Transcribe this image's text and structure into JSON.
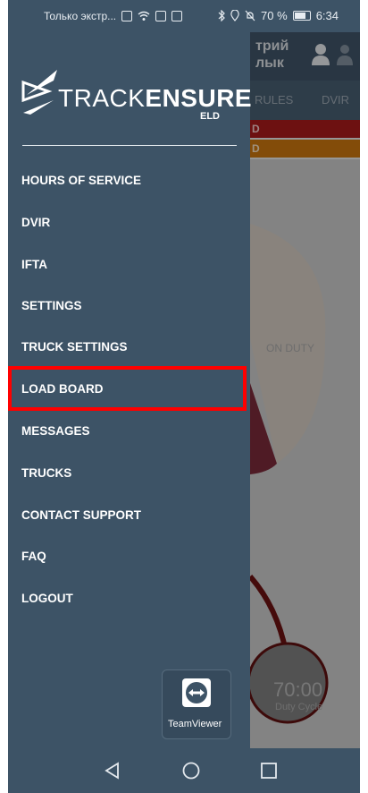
{
  "status_bar": {
    "carrier": "Только экстр...",
    "battery": "70 %",
    "time": "6:34"
  },
  "background_app": {
    "title": "трий\nлык",
    "tab_rules": "RULES",
    "tab_dvir": "DVIR",
    "alert_red": "D",
    "alert_orange": "D",
    "duty_label": "ON DUTY",
    "duty_cycle_time": "70:00",
    "duty_cycle_label": "Duty Cycle"
  },
  "drawer": {
    "brand_thin": "TRACK",
    "brand_bold": "ENSURE",
    "brand_sub": "ELD",
    "menu": [
      {
        "label": "HOURS OF SERVICE"
      },
      {
        "label": "DVIR"
      },
      {
        "label": "IFTA"
      },
      {
        "label": "SETTINGS"
      },
      {
        "label": "TRUCK SETTINGS"
      },
      {
        "label": "LOAD BOARD"
      },
      {
        "label": "MESSAGES"
      },
      {
        "label": "TRUCKS"
      },
      {
        "label": "CONTACT SUPPORT"
      },
      {
        "label": "FAQ"
      },
      {
        "label": "LOGOUT"
      }
    ],
    "teamviewer_label": "TeamViewer"
  },
  "colors": {
    "drawer_bg": "#3d5366",
    "highlight": "#ff0000",
    "alert_red": "#a81b1b",
    "alert_orange": "#c9760f"
  }
}
